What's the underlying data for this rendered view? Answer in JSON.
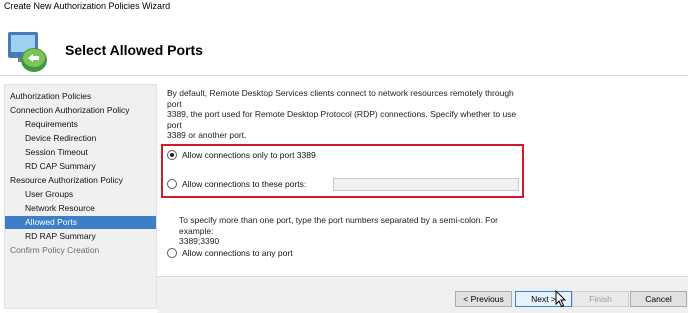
{
  "window": {
    "title": "Create New Authorization Policies Wizard"
  },
  "header": {
    "title": "Select Allowed Ports",
    "icon": "network-connection-icon"
  },
  "sidebar": {
    "items": [
      {
        "label": "Authorization Policies"
      },
      {
        "label": "Connection Authorization Policy"
      },
      {
        "label": "Requirements"
      },
      {
        "label": "Device Redirection"
      },
      {
        "label": "Session Timeout"
      },
      {
        "label": "RD CAP Summary"
      },
      {
        "label": "Resource Authorization Policy"
      },
      {
        "label": "User Groups"
      },
      {
        "label": "Network Resource"
      },
      {
        "label": "Allowed Ports",
        "selected": true
      },
      {
        "label": "RD RAP Summary"
      },
      {
        "label": "Confirm Policy Creation",
        "disabled": true
      }
    ]
  },
  "main": {
    "intro_line1": "By default, Remote Desktop Services clients connect to network resources remotely through port",
    "intro_line2": "3389, the port used for Remote Desktop Protocol (RDP) connections. Specify whether to use port",
    "intro_line3": "3389 or another port.",
    "options": {
      "port_3389": {
        "label": "Allow connections only to port 3389",
        "checked": true
      },
      "these_ports": {
        "label": "Allow connections to these ports:",
        "checked": false,
        "value": ""
      },
      "any_port": {
        "label": "Allow connections to any port",
        "checked": false
      }
    },
    "hint_line1": "To specify more than one port, type the port numbers separated by a semi-colon. For example:",
    "hint_line2": "3389;3390"
  },
  "footer": {
    "previous_label": "< Previous",
    "next_label": "Next >",
    "finish_label": "Finish",
    "cancel_label": "Cancel"
  },
  "colors": {
    "highlight": "#d11b26",
    "selection": "#3c7fc8"
  }
}
